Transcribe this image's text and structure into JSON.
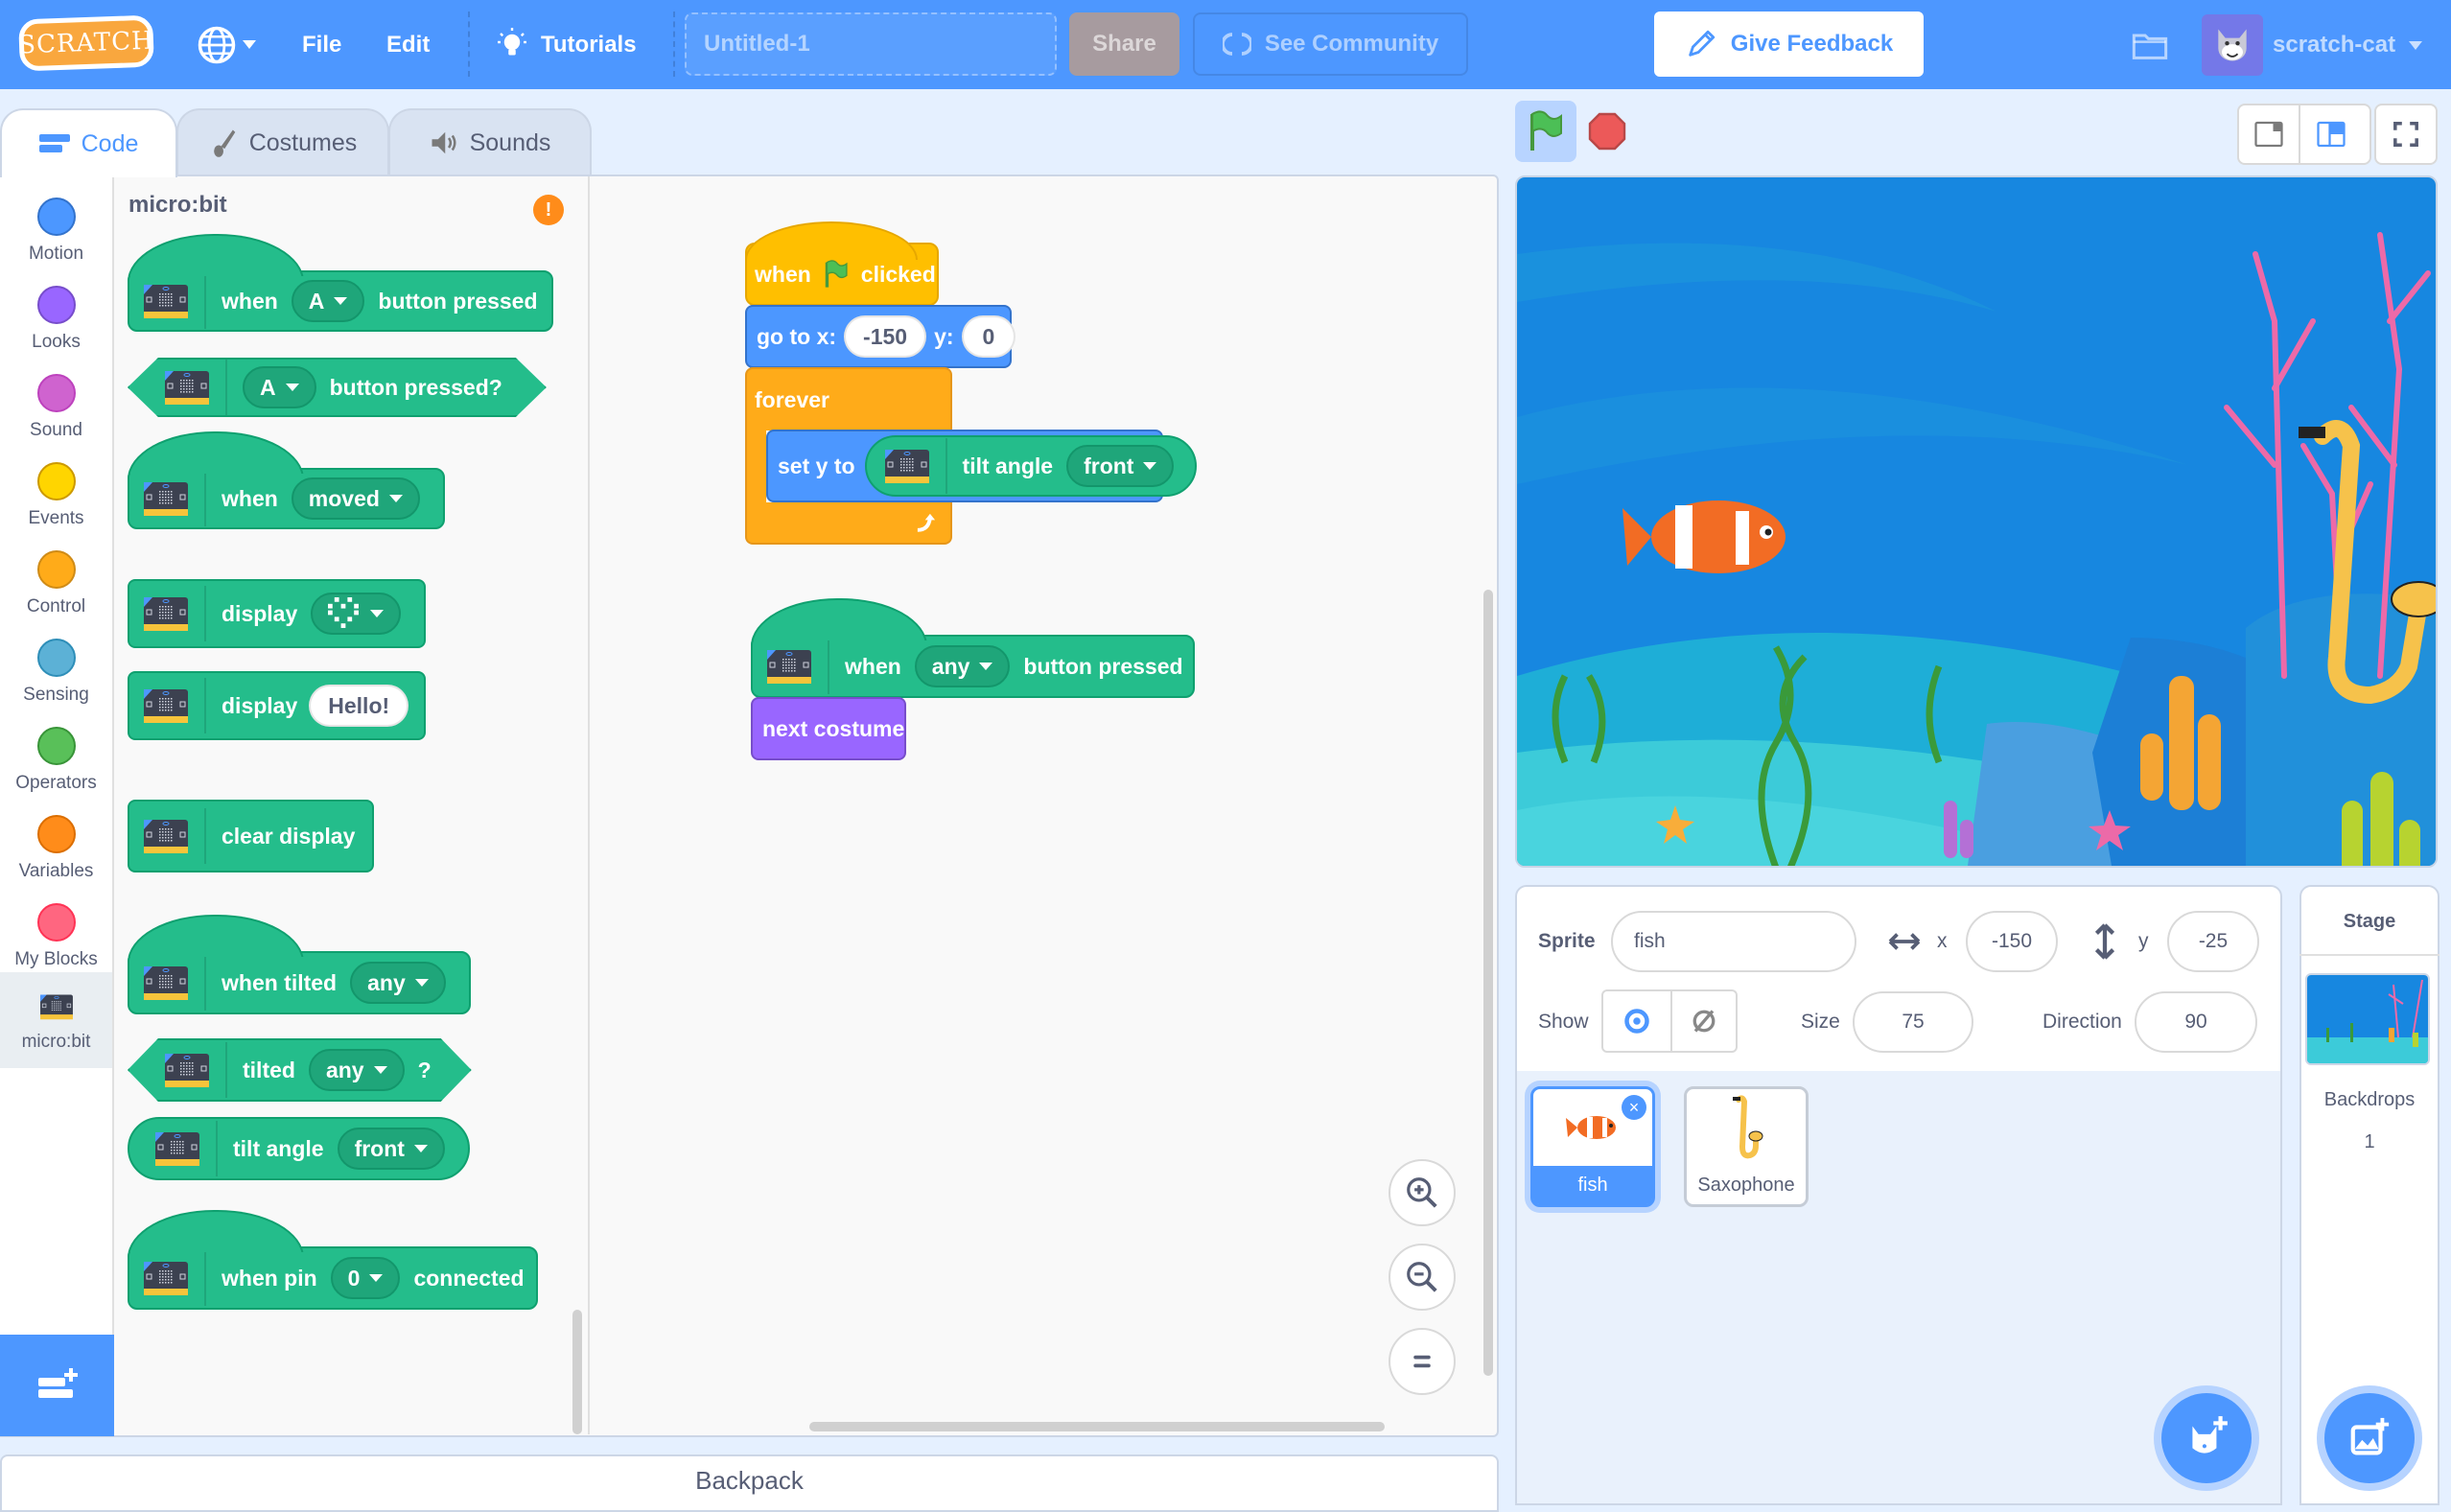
{
  "menubar": {
    "logo": "SCRATCH",
    "language_icon": "globe-icon",
    "file": "File",
    "edit": "Edit",
    "tutorials": "Tutorials",
    "project_title": "Untitled-1",
    "share": "Share",
    "see_community": "See Community",
    "give_feedback": "Give Feedback",
    "username": "scratch-cat"
  },
  "tabs": [
    {
      "label": "Code",
      "icon": "code-icon",
      "active": true
    },
    {
      "label": "Costumes",
      "icon": "brush-icon",
      "active": false
    },
    {
      "label": "Sounds",
      "icon": "speaker-icon",
      "active": false
    }
  ],
  "categories": [
    {
      "label": "Motion",
      "color": "#4c97ff"
    },
    {
      "label": "Looks",
      "color": "#9966ff"
    },
    {
      "label": "Sound",
      "color": "#cf63cf"
    },
    {
      "label": "Events",
      "color": "#ffd500"
    },
    {
      "label": "Control",
      "color": "#ffab19"
    },
    {
      "label": "Sensing",
      "color": "#5cb1d6"
    },
    {
      "label": "Operators",
      "color": "#59c059"
    },
    {
      "label": "Variables",
      "color": "#ff8c1a"
    },
    {
      "label": "My Blocks",
      "color": "#ff6680"
    },
    {
      "label": "micro:bit",
      "color": "#0fbd8c",
      "active": true
    }
  ],
  "palette": {
    "title": "micro:bit",
    "blocks": {
      "when_button": {
        "when": "when",
        "dropdown": "A",
        "tail": "button pressed"
      },
      "button_pressed": {
        "dropdown": "A",
        "tail": "button pressed?"
      },
      "when_moved": {
        "when": "when",
        "dropdown": "moved"
      },
      "display_pattern": {
        "label": "display"
      },
      "display_text": {
        "label": "display",
        "value": "Hello!"
      },
      "clear_display": {
        "label": "clear display"
      },
      "when_tilted": {
        "label": "when tilted",
        "dropdown": "any"
      },
      "tilted": {
        "label": "tilted",
        "dropdown": "any",
        "tail": "?"
      },
      "tilt_angle": {
        "label": "tilt angle",
        "dropdown": "front"
      },
      "when_pin": {
        "label": "when pin",
        "dropdown": "0",
        "tail": "connected"
      }
    }
  },
  "script": {
    "stack1": {
      "when_flag": {
        "when": "when",
        "clicked": "clicked"
      },
      "goto": {
        "label": "go to x:",
        "x": "-150",
        "ylabel": "y:",
        "y": "0"
      },
      "forever": {
        "label": "forever"
      },
      "set_y": {
        "label": "set y to",
        "reporter": "tilt angle",
        "dropdown": "front"
      }
    },
    "stack2": {
      "when_button": {
        "when": "when",
        "dropdown": "any",
        "tail": "button pressed"
      },
      "next_costume": {
        "label": "next costume"
      }
    }
  },
  "zoom_controls": {
    "zoom_in": "+",
    "zoom_out": "−",
    "reset": "="
  },
  "backpack": "Backpack",
  "sprite_info": {
    "sprite_label": "Sprite",
    "sprite_name": "fish",
    "x_label": "x",
    "x": "-150",
    "y_label": "y",
    "y": "-25",
    "show_label": "Show",
    "size_label": "Size",
    "size": "75",
    "direction_label": "Direction",
    "direction": "90"
  },
  "sprites": [
    {
      "name": "fish",
      "selected": true
    },
    {
      "name": "Saxophone",
      "selected": false
    }
  ],
  "stage_panel": {
    "title": "Stage",
    "backdrops_label": "Backdrops",
    "backdrops_count": "1"
  },
  "colors": {
    "brand": "#4d97ff",
    "extension_green": "#24bd8b",
    "events_yellow": "#ffbf00",
    "motion_blue": "#4c97ff",
    "control_orange": "#ffab19",
    "looks_purple": "#9966ff"
  }
}
